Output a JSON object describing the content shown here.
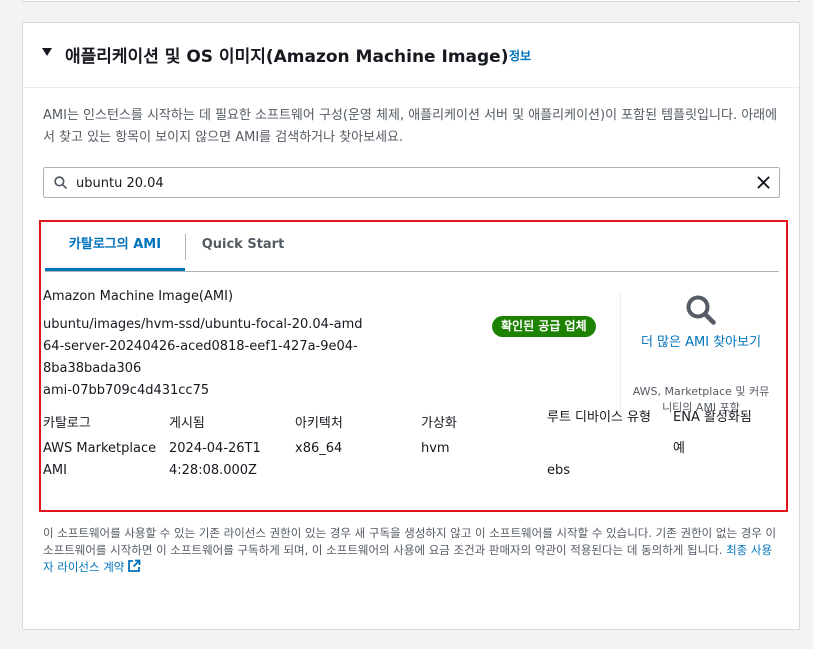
{
  "section": {
    "title": "애플리케이션 및 OS 이미지(Amazon Machine Image)",
    "info_link": "정보"
  },
  "description": "AMI는 인스턴스를 시작하는 데 필요한 소프트웨어 구성(운영 체제, 애플리케이션 서버 및 애플리케이션)이 포함된 템플릿입니다. 아래에서 찾고 있는 항목이 보이지 않으면 AMI를 검색하거나 찾아보세요.",
  "search": {
    "value": "ubuntu 20.04"
  },
  "tabs": [
    {
      "label": "카탈로그의 AMI",
      "active": true
    },
    {
      "label": "Quick Start",
      "active": false
    }
  ],
  "ami": {
    "label": "Amazon Machine Image(AMI)",
    "name": "ubuntu/images/hvm-ssd/ubuntu-focal-20.04-amd64-server-20240426-aced0818-eef1-427a-9e04-8ba38bada306",
    "id": "ami-07bb709c4d431cc75",
    "badge": "확인된 공급 업체"
  },
  "sidebar": {
    "more_link": "더 많은 AMI 찾아보기",
    "sub": "AWS, Marketplace 및 커뮤니티의 AMI 포함"
  },
  "details": {
    "headers": [
      "카탈로그",
      "게시됨",
      "아키텍처",
      "가상화",
      "루트 디바이스 유형",
      "ENA 활성화됨"
    ],
    "values": [
      "AWS Marketplace AMI",
      "2024-04-26T14:28:08.000Z",
      "x86_64",
      "hvm",
      "ebs",
      "예"
    ]
  },
  "footer": {
    "text": "이 소프트웨어를 사용할 수 있는 기존 라이선스 권한이 있는 경우 새 구독을 생성하지 않고 이 소프트웨어를 시작할 수 있습니다. 기존 권한이 없는 경우 이 소프트웨어를 시작하면 이 소프트웨어를 구독하게 되며, 이 소프트웨어의 사용에 요금 조건과 판매자의 약관이 적용된다는 데 동의하게 됩니다.",
    "link": "최종 사용자 라이선스 계약"
  },
  "colors": {
    "link": "#0073bb",
    "badge": "#1d8102",
    "highlight": "#e3141b"
  }
}
